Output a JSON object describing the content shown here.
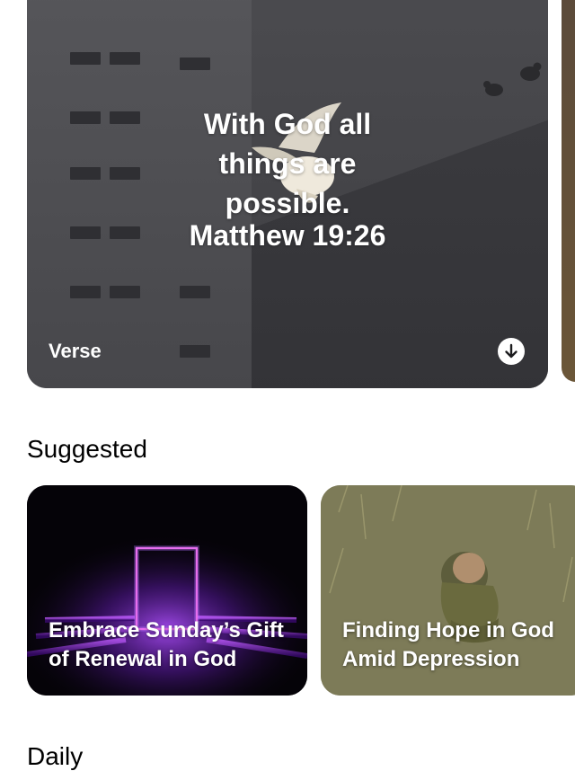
{
  "verse_card": {
    "text": "With God all things are possible.",
    "reference": "Matthew 19:26",
    "label": "Verse",
    "download_icon": "arrow-down-circle-icon"
  },
  "sections": {
    "suggested": "Suggested",
    "daily": "Daily"
  },
  "suggested_cards": [
    {
      "title": "Embrace Sunday’s Gift of Renewal in God"
    },
    {
      "title": "Finding Hope in God Amid Depression"
    }
  ]
}
